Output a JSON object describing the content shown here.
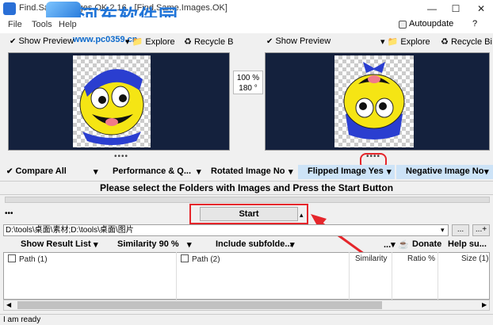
{
  "window": {
    "title": "Find.Same.Images.OK 2.16 - [Find.Same.Images.OK]",
    "minimize": "—",
    "maximize": "☐",
    "close": "✕"
  },
  "watermark": {
    "text": "河东软件园",
    "url": "www.pc0359.cn"
  },
  "menu": {
    "items": [
      "File",
      "Tools",
      "Help"
    ],
    "autoupdate": "Autoupdate",
    "help": "?"
  },
  "left_preview": {
    "show_preview": "Show Preview",
    "explore": "Explore",
    "recycle": "Recycle B"
  },
  "right_preview": {
    "show_preview": "Show Preview",
    "explore": "Explore",
    "recycle": "Recycle Bi"
  },
  "zoom": {
    "percent": "100 %",
    "angle": "180 °"
  },
  "options": {
    "compare_all": "Compare All",
    "performance": "Performance & Q...",
    "rotated": "Rotated Image No",
    "flipped": "Flipped Image Yes",
    "negative": "Negative Image No"
  },
  "message": "Please select the Folders with Images and Press the Start Button",
  "start_label": "Start",
  "path": {
    "value": "D:\\tools\\桌面\\素材;D:\\tools\\桌面\\图片",
    "browse": "...",
    "add": "...+"
  },
  "controls": {
    "show_result": "Show Result List",
    "similarity": "Similarity 90 %",
    "include": "Include subfolde...",
    "donate": "Donate",
    "help_support": "Help su..."
  },
  "table": {
    "headers": [
      "Path (1)",
      "Path (2)",
      "Similarity",
      "Ratio %",
      "Size (1)"
    ]
  },
  "status": "I am ready",
  "colors": {
    "accent_red": "#e5262b",
    "highlight": "#cde3f7",
    "panel_bg": "#14213d"
  }
}
